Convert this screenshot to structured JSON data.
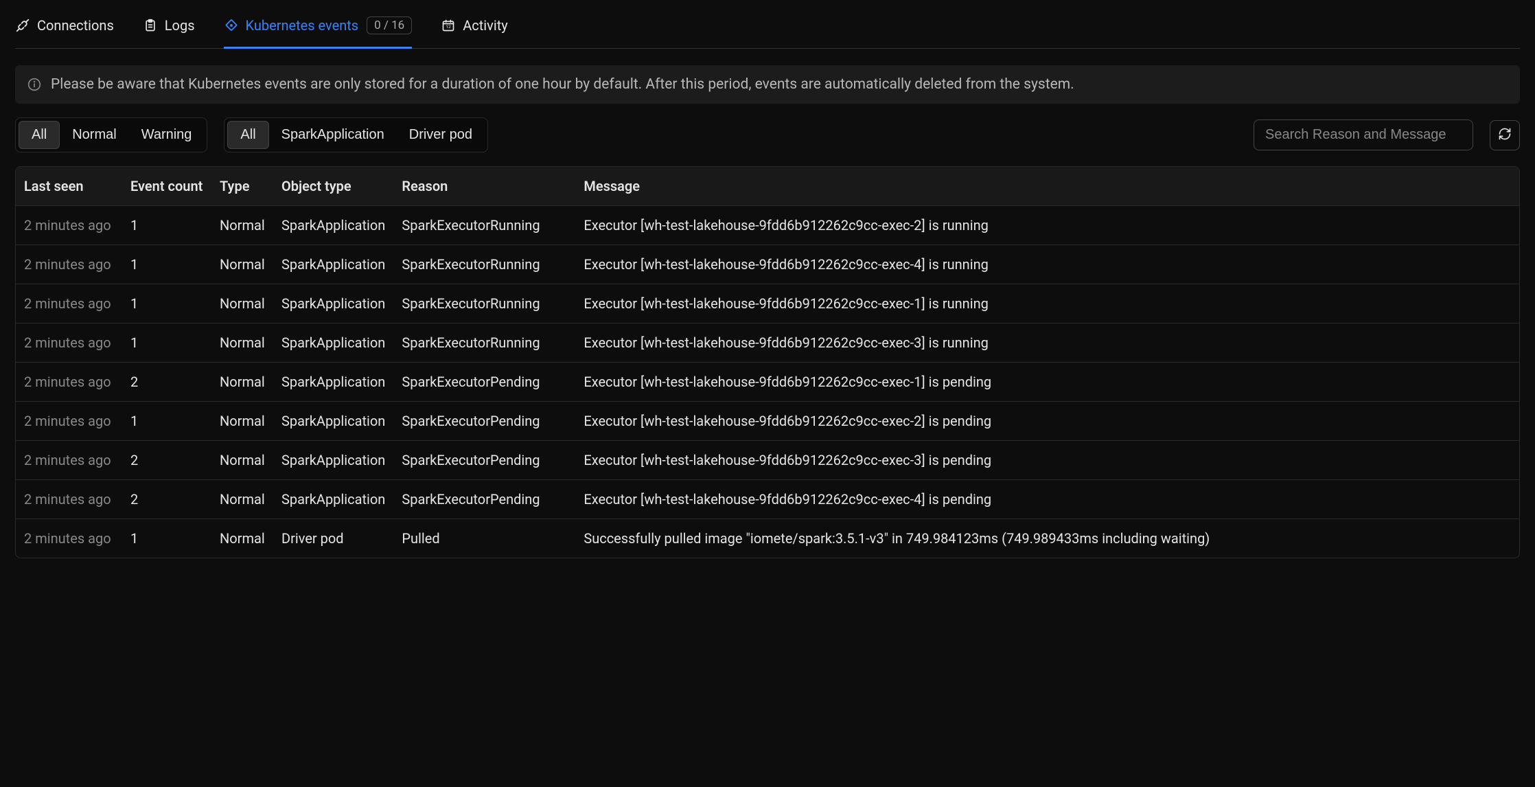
{
  "tabs": {
    "connections": "Connections",
    "logs": "Logs",
    "kubernetes_events": "Kubernetes events",
    "kubernetes_events_badge": "0 / 16",
    "activity": "Activity"
  },
  "banner": {
    "text": "Please be aware that Kubernetes events are only stored for a duration of one hour by default. After this period, events are automatically deleted from the system."
  },
  "filters": {
    "type_group": {
      "all": "All",
      "normal": "Normal",
      "warning": "Warning"
    },
    "object_group": {
      "all": "All",
      "spark_application": "SparkApplication",
      "driver_pod": "Driver pod"
    }
  },
  "search": {
    "placeholder": "Search Reason and Message"
  },
  "table": {
    "headers": {
      "last_seen": "Last seen",
      "event_count": "Event count",
      "type": "Type",
      "object_type": "Object type",
      "reason": "Reason",
      "message": "Message"
    },
    "rows": [
      {
        "last_seen": "2 minutes ago",
        "event_count": "1",
        "type": "Normal",
        "object_type": "SparkApplication",
        "reason": "SparkExecutorRunning",
        "message": "Executor [wh-test-lakehouse-9fdd6b912262c9cc-exec-2] is running"
      },
      {
        "last_seen": "2 minutes ago",
        "event_count": "1",
        "type": "Normal",
        "object_type": "SparkApplication",
        "reason": "SparkExecutorRunning",
        "message": "Executor [wh-test-lakehouse-9fdd6b912262c9cc-exec-4] is running"
      },
      {
        "last_seen": "2 minutes ago",
        "event_count": "1",
        "type": "Normal",
        "object_type": "SparkApplication",
        "reason": "SparkExecutorRunning",
        "message": "Executor [wh-test-lakehouse-9fdd6b912262c9cc-exec-1] is running"
      },
      {
        "last_seen": "2 minutes ago",
        "event_count": "1",
        "type": "Normal",
        "object_type": "SparkApplication",
        "reason": "SparkExecutorRunning",
        "message": "Executor [wh-test-lakehouse-9fdd6b912262c9cc-exec-3] is running"
      },
      {
        "last_seen": "2 minutes ago",
        "event_count": "2",
        "type": "Normal",
        "object_type": "SparkApplication",
        "reason": "SparkExecutorPending",
        "message": "Executor [wh-test-lakehouse-9fdd6b912262c9cc-exec-1] is pending"
      },
      {
        "last_seen": "2 minutes ago",
        "event_count": "1",
        "type": "Normal",
        "object_type": "SparkApplication",
        "reason": "SparkExecutorPending",
        "message": "Executor [wh-test-lakehouse-9fdd6b912262c9cc-exec-2] is pending"
      },
      {
        "last_seen": "2 minutes ago",
        "event_count": "2",
        "type": "Normal",
        "object_type": "SparkApplication",
        "reason": "SparkExecutorPending",
        "message": "Executor [wh-test-lakehouse-9fdd6b912262c9cc-exec-3] is pending"
      },
      {
        "last_seen": "2 minutes ago",
        "event_count": "2",
        "type": "Normal",
        "object_type": "SparkApplication",
        "reason": "SparkExecutorPending",
        "message": "Executor [wh-test-lakehouse-9fdd6b912262c9cc-exec-4] is pending"
      },
      {
        "last_seen": "2 minutes ago",
        "event_count": "1",
        "type": "Normal",
        "object_type": "Driver pod",
        "reason": "Pulled",
        "message": "Successfully pulled image \"iomete/spark:3.5.1-v3\" in 749.984123ms (749.989433ms including waiting)"
      }
    ]
  }
}
